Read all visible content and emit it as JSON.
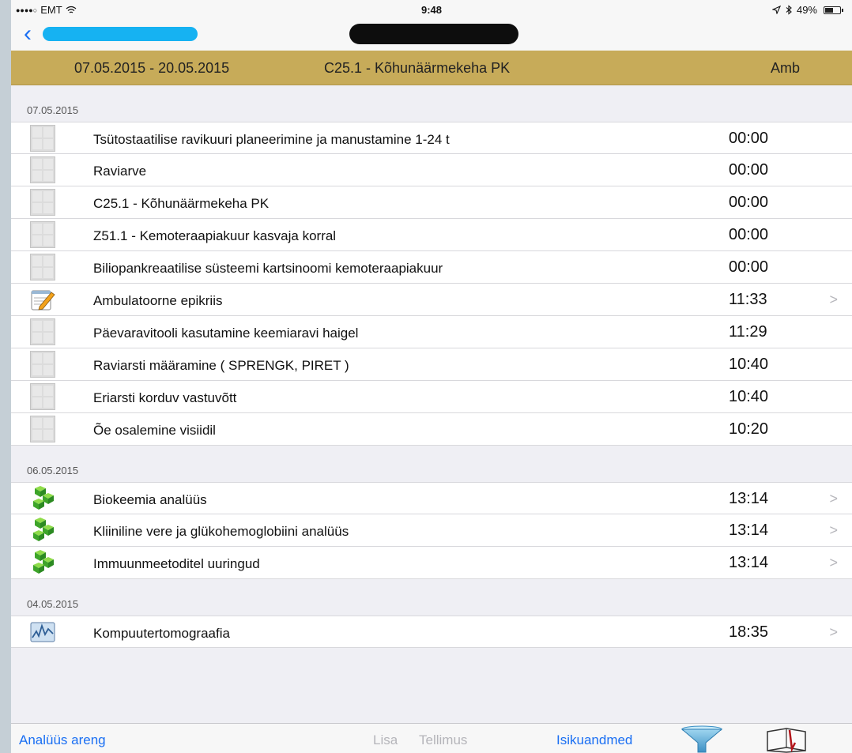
{
  "status_bar": {
    "carrier": "EMT",
    "time": "9:48",
    "battery": "49%"
  },
  "episode": {
    "date_range": "07.05.2015 - 20.05.2015",
    "diagnosis": "C25.1 - Kõhunäärmekeha PK",
    "type": "Amb"
  },
  "groups": [
    {
      "date": "07.05.2015",
      "items": [
        {
          "icon": "document-grid-icon",
          "title": "Tsütostaatilise ravikuuri planeerimine ja manustamine 1-24 t",
          "time": "00:00",
          "chevron": ""
        },
        {
          "icon": "document-grid-icon",
          "title": "Raviarve",
          "time": "00:00",
          "chevron": ""
        },
        {
          "icon": "document-grid-icon",
          "title": "C25.1 - Kõhunäärmekeha PK",
          "time": "00:00",
          "chevron": ""
        },
        {
          "icon": "document-grid-icon",
          "title": "Z51.1 - Kemoteraapiakuur kasvaja korral",
          "time": "00:00",
          "chevron": ""
        },
        {
          "icon": "document-grid-icon",
          "title": "Biliopankreaatilise süsteemi kartsinoomi kemoteraapiakuur",
          "time": "00:00",
          "chevron": ""
        },
        {
          "icon": "notepad-pencil-icon",
          "title": "Ambulatoorne epikriis",
          "time": "11:33",
          "chevron": ">"
        },
        {
          "icon": "document-grid-icon",
          "title": "Päevaravitooli kasutamine keemiaravi haigel",
          "time": "11:29",
          "chevron": ""
        },
        {
          "icon": "document-grid-icon",
          "title": "Raviarsti määramine ( SPRENGK, PIRET )",
          "time": "10:40",
          "chevron": ""
        },
        {
          "icon": "document-grid-icon",
          "title": "Eriarsti korduv vastuvõtt",
          "time": "10:40",
          "chevron": ""
        },
        {
          "icon": "document-grid-icon",
          "title": "Õe osalemine visiidil",
          "time": "10:20",
          "chevron": ""
        }
      ]
    },
    {
      "date": "06.05.2015",
      "items": [
        {
          "icon": "green-cubes-icon",
          "title": "Biokeemia analüüs",
          "time": "13:14",
          "chevron": ">"
        },
        {
          "icon": "green-cubes-icon",
          "title": "Kliiniline vere ja glükohemoglobiini analüüs",
          "time": "13:14",
          "chevron": ">"
        },
        {
          "icon": "green-cubes-icon",
          "title": "Immuunmeetoditel uuringud",
          "time": "13:14",
          "chevron": ">"
        }
      ]
    },
    {
      "date": "04.05.2015",
      "items": [
        {
          "icon": "waveform-monitor-icon",
          "title": "Kompuutertomograafia",
          "time": "18:35",
          "chevron": ">"
        }
      ]
    }
  ],
  "toolbar": {
    "analysis_label": "Analüüs areng",
    "add_label": "Lisa",
    "order_label": "Tellimus",
    "personal_label": "Isikuandmed",
    "filter_icon": "funnel-icon",
    "book_icon": "book-icon"
  },
  "colors": {
    "accent": "#1a6ff3",
    "header_gold": "#c7ab59",
    "redaction_blue": "#16b2f2"
  }
}
